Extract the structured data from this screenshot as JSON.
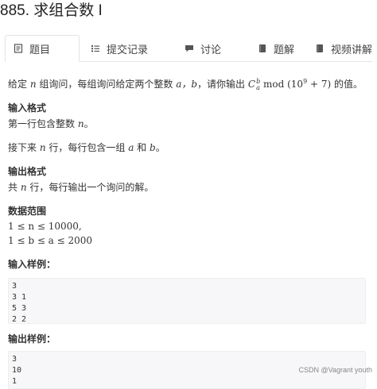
{
  "page": {
    "title": "885. 求组合数 I"
  },
  "tabs": [
    {
      "label": "题目",
      "icon": "document-icon",
      "active": true
    },
    {
      "label": "提交记录",
      "icon": "list-icon",
      "active": false
    },
    {
      "label": "讨论",
      "icon": "comment-icon",
      "active": false
    },
    {
      "label": "题解",
      "icon": "book-icon",
      "active": false
    },
    {
      "label": "视频讲解",
      "icon": "video-icon",
      "active": false
    }
  ],
  "problem": {
    "intro_a": "给定 ",
    "intro_n": "n",
    "intro_b": " 组询问，每组询问给定两个整数 ",
    "intro_vars": "a，b",
    "intro_c": "，请你输出 ",
    "intro_formula": "C",
    "intro_formula_sup": "b",
    "intro_formula_sub": "a",
    "intro_mod": " mod (10",
    "intro_exp": "9",
    "intro_tail": " + 7)",
    "intro_end": " 的值。",
    "input_heading": "输入格式",
    "input_line1_a": "第一行包含整数 ",
    "input_line1_var": "n",
    "input_line1_b": "。",
    "input_line2_a": "接下来 ",
    "input_line2_var": "n",
    "input_line2_b": " 行，每行包含一组 ",
    "input_line2_a_var": "a",
    "input_line2_c": " 和 ",
    "input_line2_b_var": "b",
    "input_line2_d": "。",
    "output_heading": "输出格式",
    "output_line_a": "共 ",
    "output_line_var": "n",
    "output_line_b": " 行，每行输出一个询问的解。",
    "range_heading": "数据范围",
    "range_line1": "1 ≤ n ≤ 10000,",
    "range_line2": "1 ≤ b ≤ a ≤ 2000",
    "sample_input_heading": "输入样例：",
    "sample_input": "3\n3 1\n5 3\n2 2",
    "sample_output_heading": "输出样例：",
    "sample_output": "3\n10\n1"
  },
  "watermark": "CSDN @Vagrant youth"
}
